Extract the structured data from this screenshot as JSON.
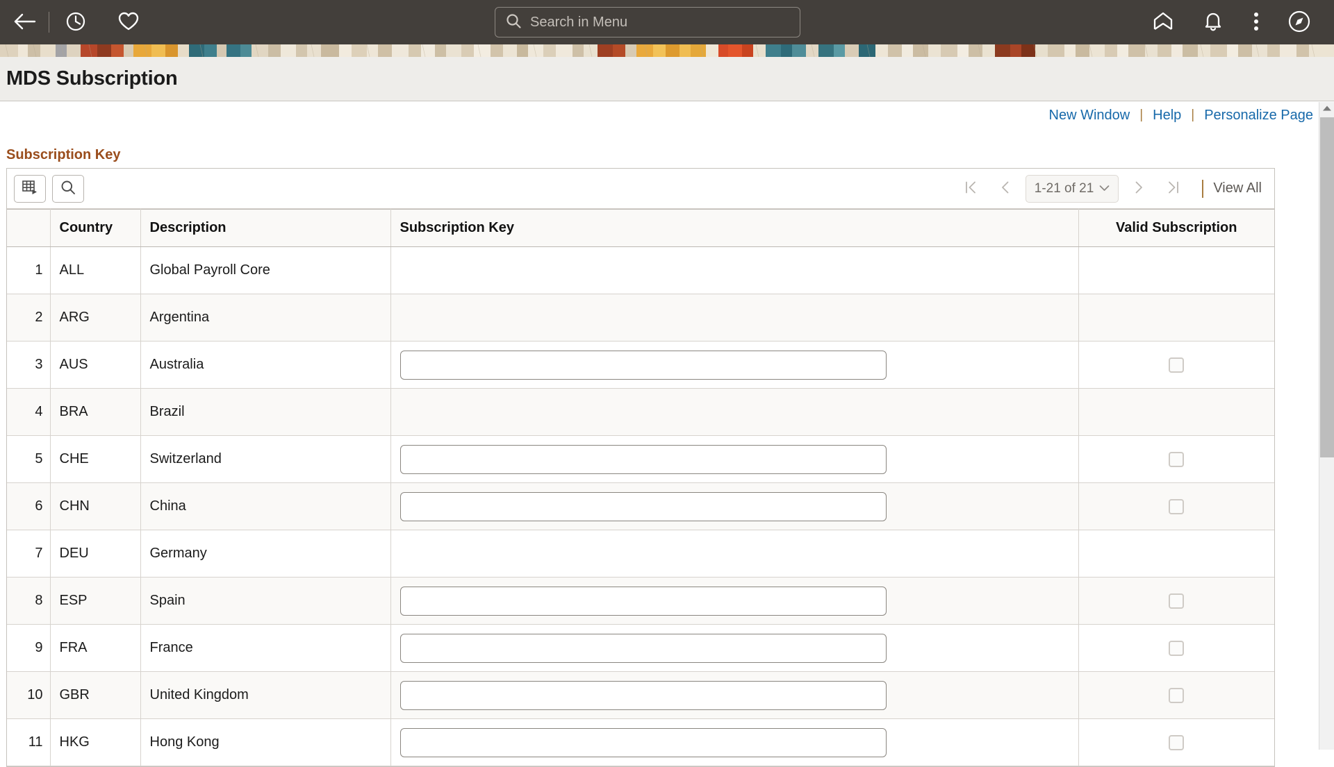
{
  "topbar": {
    "background": "#433f3b",
    "back_icon": "back-arrow-icon",
    "recent_icon": "clock-icon",
    "favorite_icon": "heart-icon",
    "home_icon": "home-icon",
    "notifications_icon": "bell-icon",
    "actions_icon": "kebab-menu-icon",
    "navbar_icon": "compass-icon",
    "search": {
      "placeholder": "Search in Menu",
      "value": "",
      "icon": "search-icon"
    }
  },
  "page": {
    "title": "MDS Subscription"
  },
  "header_links": [
    {
      "label": "New Window"
    },
    {
      "label": "Help"
    },
    {
      "label": "Personalize Page"
    }
  ],
  "link_separator": "|",
  "group_box": {
    "label": "Subscription Key"
  },
  "grid_toolbar": {
    "personalize_icon": "grid-personalize-icon",
    "find_icon": "search-icon",
    "pager": {
      "first_icon": "first-page-icon",
      "prev_icon": "previous-page-icon",
      "range_label": "1-21 of 21",
      "chevron_icon": "chevron-down-icon",
      "next_icon": "next-page-icon",
      "last_icon": "last-page-icon",
      "separator": "|",
      "view_all_label": "View All"
    }
  },
  "table": {
    "columns": [
      {
        "key": "num",
        "label": ""
      },
      {
        "key": "country",
        "label": "Country"
      },
      {
        "key": "desc",
        "label": "Description"
      },
      {
        "key": "subkey",
        "label": "Subscription Key"
      },
      {
        "key": "valid",
        "label": "Valid Subscription"
      }
    ],
    "rows": [
      {
        "num": "1",
        "country": "ALL",
        "desc": "Global Payroll Core",
        "subkey": null,
        "subkey_value": "",
        "valid": null,
        "valid_checked": false
      },
      {
        "num": "2",
        "country": "ARG",
        "desc": "Argentina",
        "subkey": null,
        "subkey_value": "",
        "valid": null,
        "valid_checked": false
      },
      {
        "num": "3",
        "country": "AUS",
        "desc": "Australia",
        "subkey": "input",
        "subkey_value": "",
        "valid": "checkbox",
        "valid_checked": false
      },
      {
        "num": "4",
        "country": "BRA",
        "desc": "Brazil",
        "subkey": null,
        "subkey_value": "",
        "valid": null,
        "valid_checked": false
      },
      {
        "num": "5",
        "country": "CHE",
        "desc": "Switzerland",
        "subkey": "input",
        "subkey_value": "",
        "valid": "checkbox",
        "valid_checked": false
      },
      {
        "num": "6",
        "country": "CHN",
        "desc": "China",
        "subkey": "input",
        "subkey_value": "",
        "valid": "checkbox",
        "valid_checked": false
      },
      {
        "num": "7",
        "country": "DEU",
        "desc": "Germany",
        "subkey": null,
        "subkey_value": "",
        "valid": null,
        "valid_checked": false
      },
      {
        "num": "8",
        "country": "ESP",
        "desc": "Spain",
        "subkey": "input",
        "subkey_value": "",
        "valid": "checkbox",
        "valid_checked": false
      },
      {
        "num": "9",
        "country": "FRA",
        "desc": "France",
        "subkey": "input",
        "subkey_value": "",
        "valid": "checkbox",
        "valid_checked": false
      },
      {
        "num": "10",
        "country": "GBR",
        "desc": "United Kingdom",
        "subkey": "input",
        "subkey_value": "",
        "valid": "checkbox",
        "valid_checked": false
      },
      {
        "num": "11",
        "country": "HKG",
        "desc": "Hong Kong",
        "subkey": "input",
        "subkey_value": "",
        "valid": "checkbox",
        "valid_checked": false
      }
    ]
  },
  "scrollbar": {
    "up_icon": "scroll-up-icon"
  },
  "colors": {
    "topbar": "#433f3b",
    "link": "#1769aa",
    "group_label": "#9a4d1c",
    "accent_divider": "#a87d40",
    "title_bar": "#eeedea"
  }
}
